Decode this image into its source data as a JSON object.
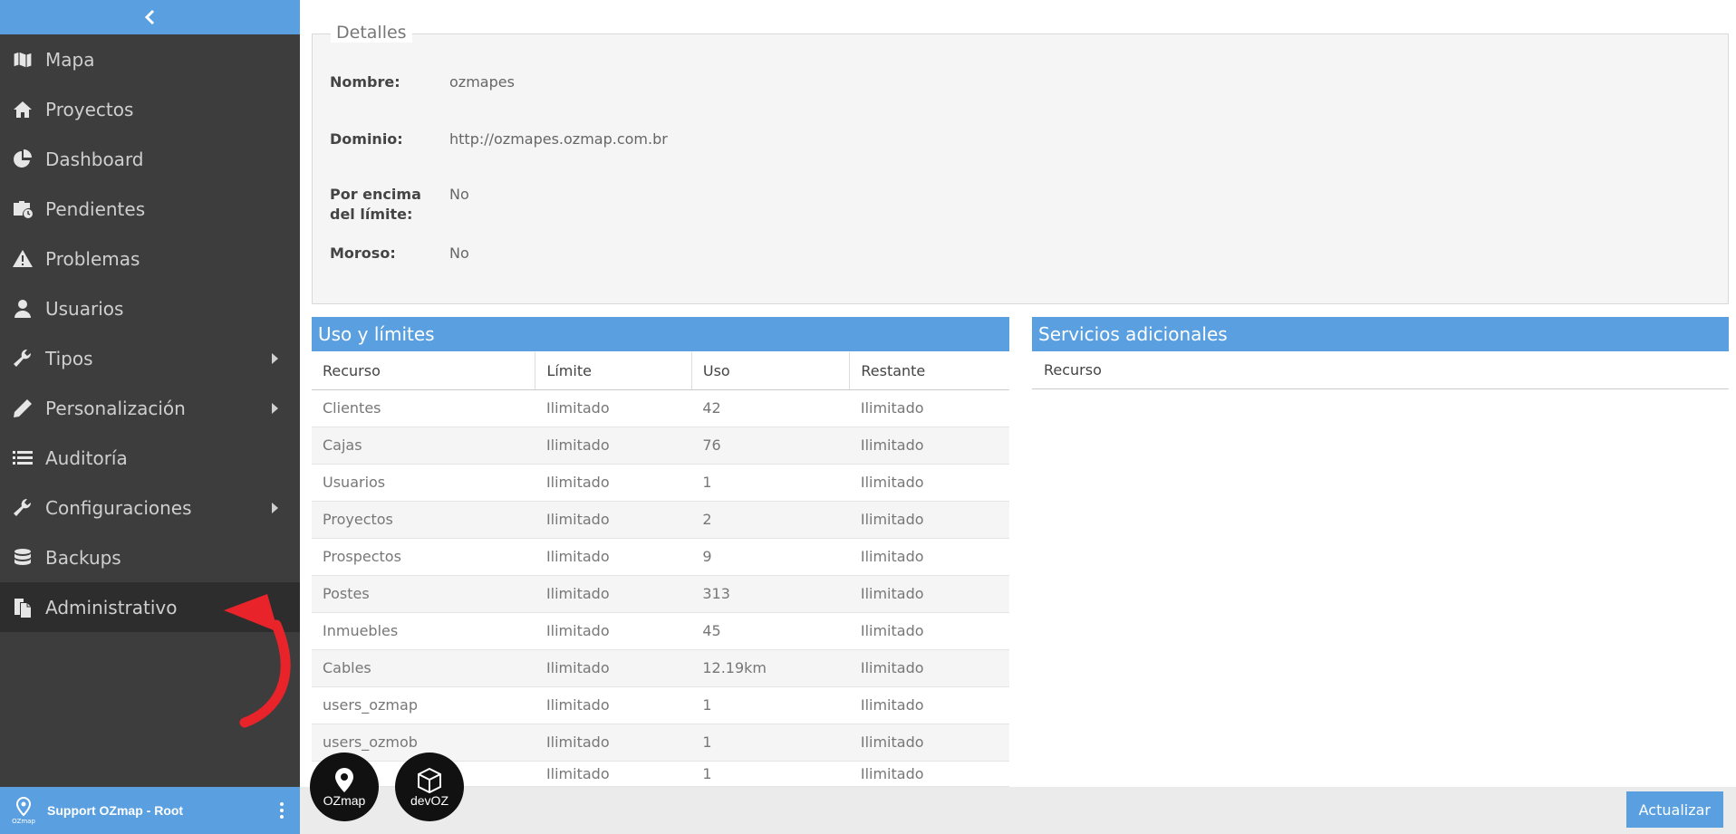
{
  "sidebar": {
    "collapse_icon": "chevron-left-icon",
    "items": [
      {
        "label": "Mapa",
        "icon": "map-icon"
      },
      {
        "label": "Proyectos",
        "icon": "home-icon"
      },
      {
        "label": "Dashboard",
        "icon": "pie-chart-icon"
      },
      {
        "label": "Pendientes",
        "icon": "briefcase-clock-icon"
      },
      {
        "label": "Problemas",
        "icon": "warning-icon"
      },
      {
        "label": "Usuarios",
        "icon": "user-icon"
      },
      {
        "label": "Tipos",
        "icon": "wrench-icon"
      },
      {
        "label": "Personalización",
        "icon": "pencil-icon"
      },
      {
        "label": "Auditoría",
        "icon": "list-icon"
      },
      {
        "label": "Configuraciones",
        "icon": "wrench-icon"
      },
      {
        "label": "Backups",
        "icon": "database-icon"
      },
      {
        "label": "Administrativo",
        "icon": "copy-document-icon"
      }
    ],
    "footer": {
      "user": "Support OZmap - Root",
      "logo_text": "OZmap"
    }
  },
  "details": {
    "legend": "Detalles",
    "fields": [
      {
        "label": "Nombre:",
        "value": "ozmapes"
      },
      {
        "label": "Dominio:",
        "value": "http://ozmapes.ozmap.com.br"
      },
      {
        "label": "Por encima del límite:",
        "value": "No"
      },
      {
        "label": "Moroso:",
        "value": "No"
      }
    ]
  },
  "usage": {
    "title": "Uso y límites",
    "columns": [
      "Recurso",
      "Límite",
      "Uso",
      "Restante"
    ],
    "rows": [
      [
        "Clientes",
        "Ilimitado",
        "42",
        "Ilimitado"
      ],
      [
        "Cajas",
        "Ilimitado",
        "76",
        "Ilimitado"
      ],
      [
        "Usuarios",
        "Ilimitado",
        "1",
        "Ilimitado"
      ],
      [
        "Proyectos",
        "Ilimitado",
        "2",
        "Ilimitado"
      ],
      [
        "Prospectos",
        "Ilimitado",
        "9",
        "Ilimitado"
      ],
      [
        "Postes",
        "Ilimitado",
        "313",
        "Ilimitado"
      ],
      [
        "Inmuebles",
        "Ilimitado",
        "45",
        "Ilimitado"
      ],
      [
        "Cables",
        "Ilimitado",
        "12.19km",
        "Ilimitado"
      ],
      [
        "users_ozmap",
        "Ilimitado",
        "1",
        "Ilimitado"
      ],
      [
        "users_ozmob",
        "Ilimitado",
        "1",
        "Ilimitado"
      ],
      [
        "",
        "Ilimitado",
        "1",
        "Ilimitado"
      ]
    ]
  },
  "services": {
    "title": "Servicios adicionales",
    "column": "Recurso"
  },
  "bottom": {
    "update_label": "Actualizar",
    "badge_ozmap": "OZmap",
    "badge_devoz": "devOZ"
  },
  "colors": {
    "accent": "#5aa0e0",
    "sidebar": "#3d3d3d",
    "annotation": "#e8242a"
  }
}
